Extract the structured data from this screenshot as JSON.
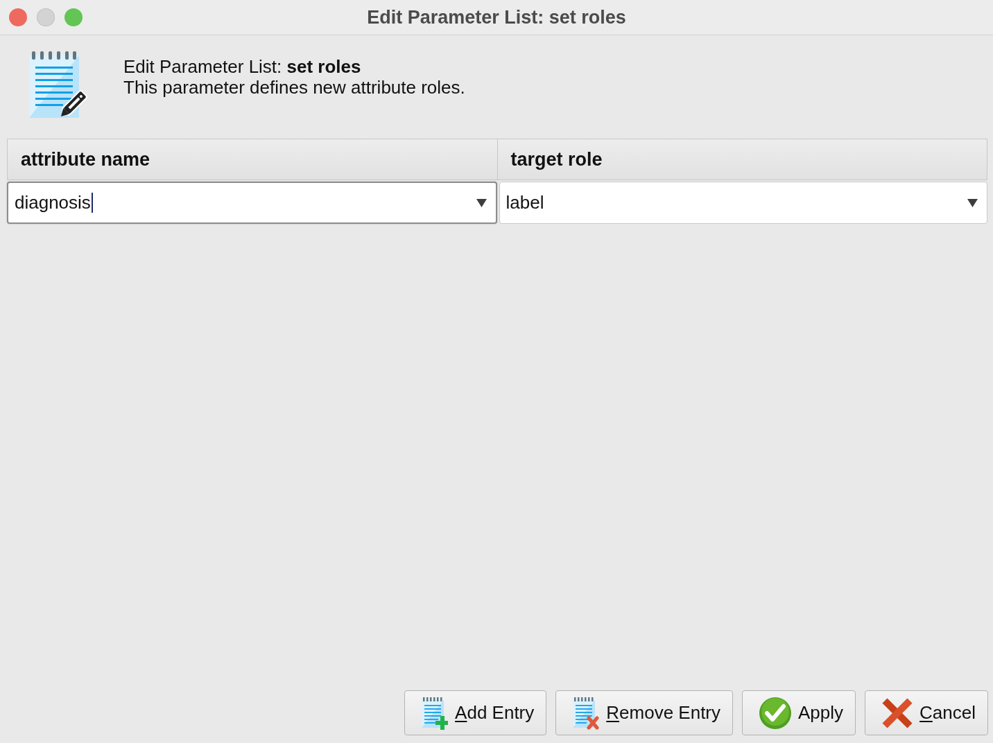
{
  "window": {
    "title": "Edit Parameter List: set roles"
  },
  "header": {
    "title": "Edit Parameter List: **set roles**",
    "description": "This parameter defines new attribute roles."
  },
  "table": {
    "columns": [
      "attribute name",
      "target role"
    ],
    "rows": [
      [
        {
          "value": "diagnosis",
          "focused": true
        },
        {
          "value": "label",
          "focused": false
        }
      ]
    ]
  },
  "buttons": [
    {
      "label": "Add Entry",
      "kind": "add",
      "mnemonic": true
    },
    {
      "label": "Remove Entry",
      "kind": "remove",
      "mnemonic": true
    },
    {
      "label": "Apply",
      "kind": "apply",
      "mnemonic": false
    },
    {
      "label": "Cancel",
      "kind": "cancel",
      "mnemonic": true
    }
  ]
}
